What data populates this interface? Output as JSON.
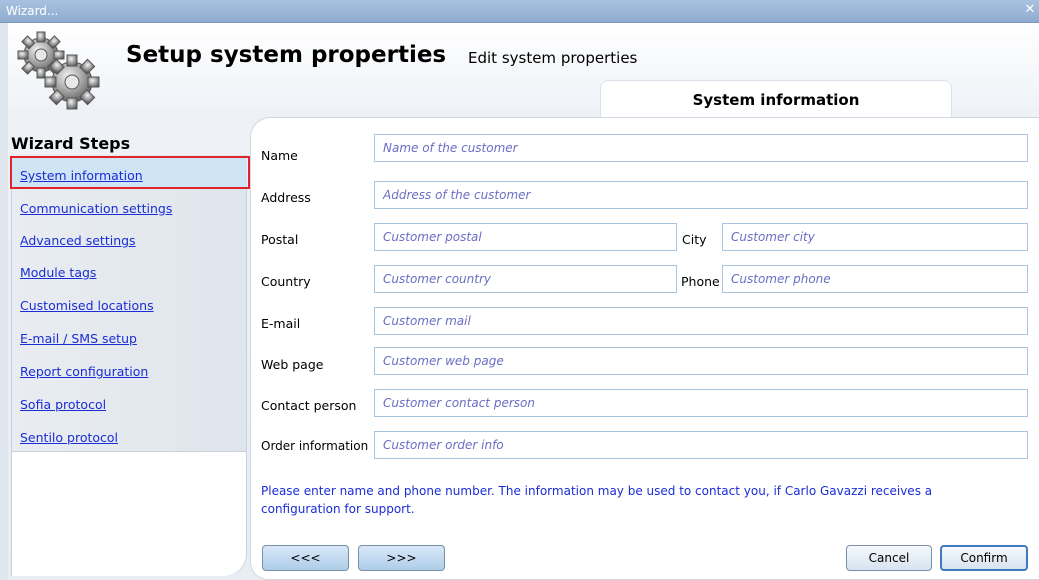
{
  "window": {
    "title": "Wizard...",
    "close_glyph": "✕"
  },
  "header": {
    "title": "Setup system properties",
    "subtitle": "Edit system properties",
    "logo_icon": "gears-icon"
  },
  "tab": {
    "label": "System information"
  },
  "sidebar": {
    "title": "Wizard Steps",
    "steps": [
      {
        "label": "System information",
        "active": true
      },
      {
        "label": "Communication settings"
      },
      {
        "label": "Advanced settings"
      },
      {
        "label": "Module tags"
      },
      {
        "label": "Customised locations"
      },
      {
        "label": "E-mail / SMS setup"
      },
      {
        "label": "Report configuration"
      },
      {
        "label": "Sofia protocol"
      },
      {
        "label": "Sentilo protocol"
      }
    ]
  },
  "form": {
    "name": {
      "label": "Name",
      "placeholder": "Name of the customer"
    },
    "address": {
      "label": "Address",
      "placeholder": "Address of the customer"
    },
    "postal": {
      "label": "Postal",
      "placeholder": "Customer postal"
    },
    "city": {
      "label": "City",
      "placeholder": "Customer city"
    },
    "country": {
      "label": "Country",
      "placeholder": "Customer country"
    },
    "phone": {
      "label": "Phone",
      "placeholder": "Customer phone"
    },
    "email": {
      "label": "E-mail",
      "placeholder": "Customer mail"
    },
    "webpage": {
      "label": "Web page",
      "placeholder": "Customer web page"
    },
    "contact": {
      "label": "Contact person",
      "placeholder": "Customer contact person"
    },
    "order": {
      "label": "Order information",
      "placeholder": "Customer order info"
    },
    "note": "Please enter name and phone number. The information may be used to contact you, if Carlo Gavazzi receives a configuration for support."
  },
  "buttons": {
    "prev": "<<<",
    "next": ">>>",
    "cancel": "Cancel",
    "confirm": "Confirm"
  },
  "colors": {
    "link": "#1a2dd6",
    "highlight_border": "#e0242b",
    "placeholder": "#6a6ec4",
    "field_border": "#a9c4df"
  }
}
